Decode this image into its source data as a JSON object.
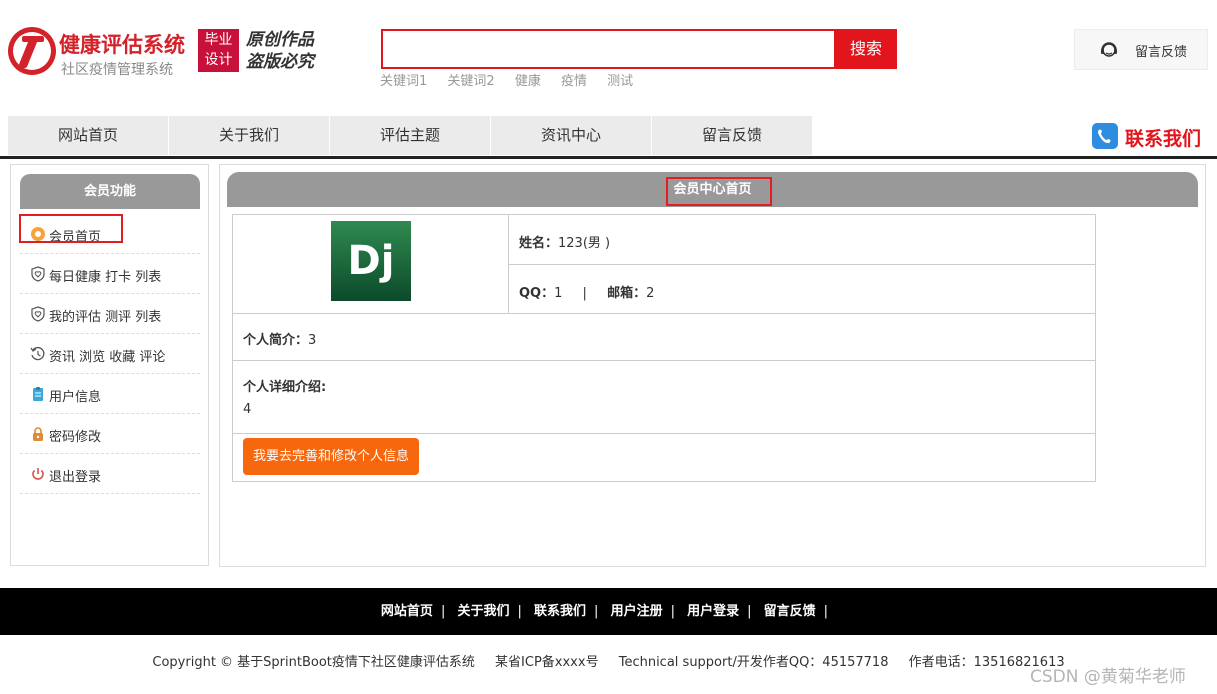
{
  "header": {
    "brand_title": "健康评估系统",
    "brand_subtitle": "社区疫情管理系统",
    "badge_line1": "毕业",
    "badge_line2": "设计",
    "slogan_line1": "原创作品",
    "slogan_line2": "盗版必究",
    "search_value": "",
    "search_button": "搜索",
    "keywords": [
      "关键词1",
      "关键词2",
      "健康",
      "疫情",
      "测试"
    ],
    "feedback_label": "留言反馈"
  },
  "nav": {
    "items": [
      "网站首页",
      "关于我们",
      "评估主题",
      "资讯中心",
      "留言反馈"
    ],
    "contact_label": "联系我们"
  },
  "sidebar": {
    "title": "会员功能",
    "items": [
      {
        "label": "会员首页",
        "icon": "orange-dot-icon"
      },
      {
        "label": "每日健康 打卡 列表",
        "icon": "shield-heart-icon"
      },
      {
        "label": "我的评估 测评 列表",
        "icon": "shield-heart-icon"
      },
      {
        "label": "资讯 浏览 收藏 评论",
        "icon": "history-icon"
      },
      {
        "label": "用户信息",
        "icon": "clipboard-icon"
      },
      {
        "label": "密码修改",
        "icon": "lock-icon"
      },
      {
        "label": "退出登录",
        "icon": "power-icon"
      }
    ]
  },
  "main": {
    "title": "会员中心首页",
    "avatar_text": "Dj",
    "name_label": "姓名：",
    "name_value": "123(男 )",
    "qq_label": "QQ：",
    "qq_value": "1",
    "separator": "|",
    "email_label": "邮箱：",
    "email_value": "2",
    "intro_label": "个人简介：",
    "intro_value": "3",
    "detail_label": "个人详细介绍:",
    "detail_value": "4",
    "edit_button": "我要去完善和修改个人信息"
  },
  "footer": {
    "links": [
      "网站首页",
      "关于我们",
      "联系我们",
      "用户注册",
      "用户登录",
      "留言反馈"
    ],
    "copyright": "Copyright © 基于SprintBoot疫情下社区健康评估系统",
    "icp": "某省ICP备xxxx号",
    "support": "Technical support/开发作者QQ：45157718",
    "phone": "作者电话：13516821613"
  },
  "watermark": "CSDN @黄菊华老师",
  "colors": {
    "brand_red": "#d3222a",
    "search_red": "#e2141c",
    "badge_red": "#c8113a",
    "header_gray": "#999999",
    "nav_gray": "#ebebeb",
    "button_orange": "#f7670e",
    "footer_black": "#000000"
  }
}
